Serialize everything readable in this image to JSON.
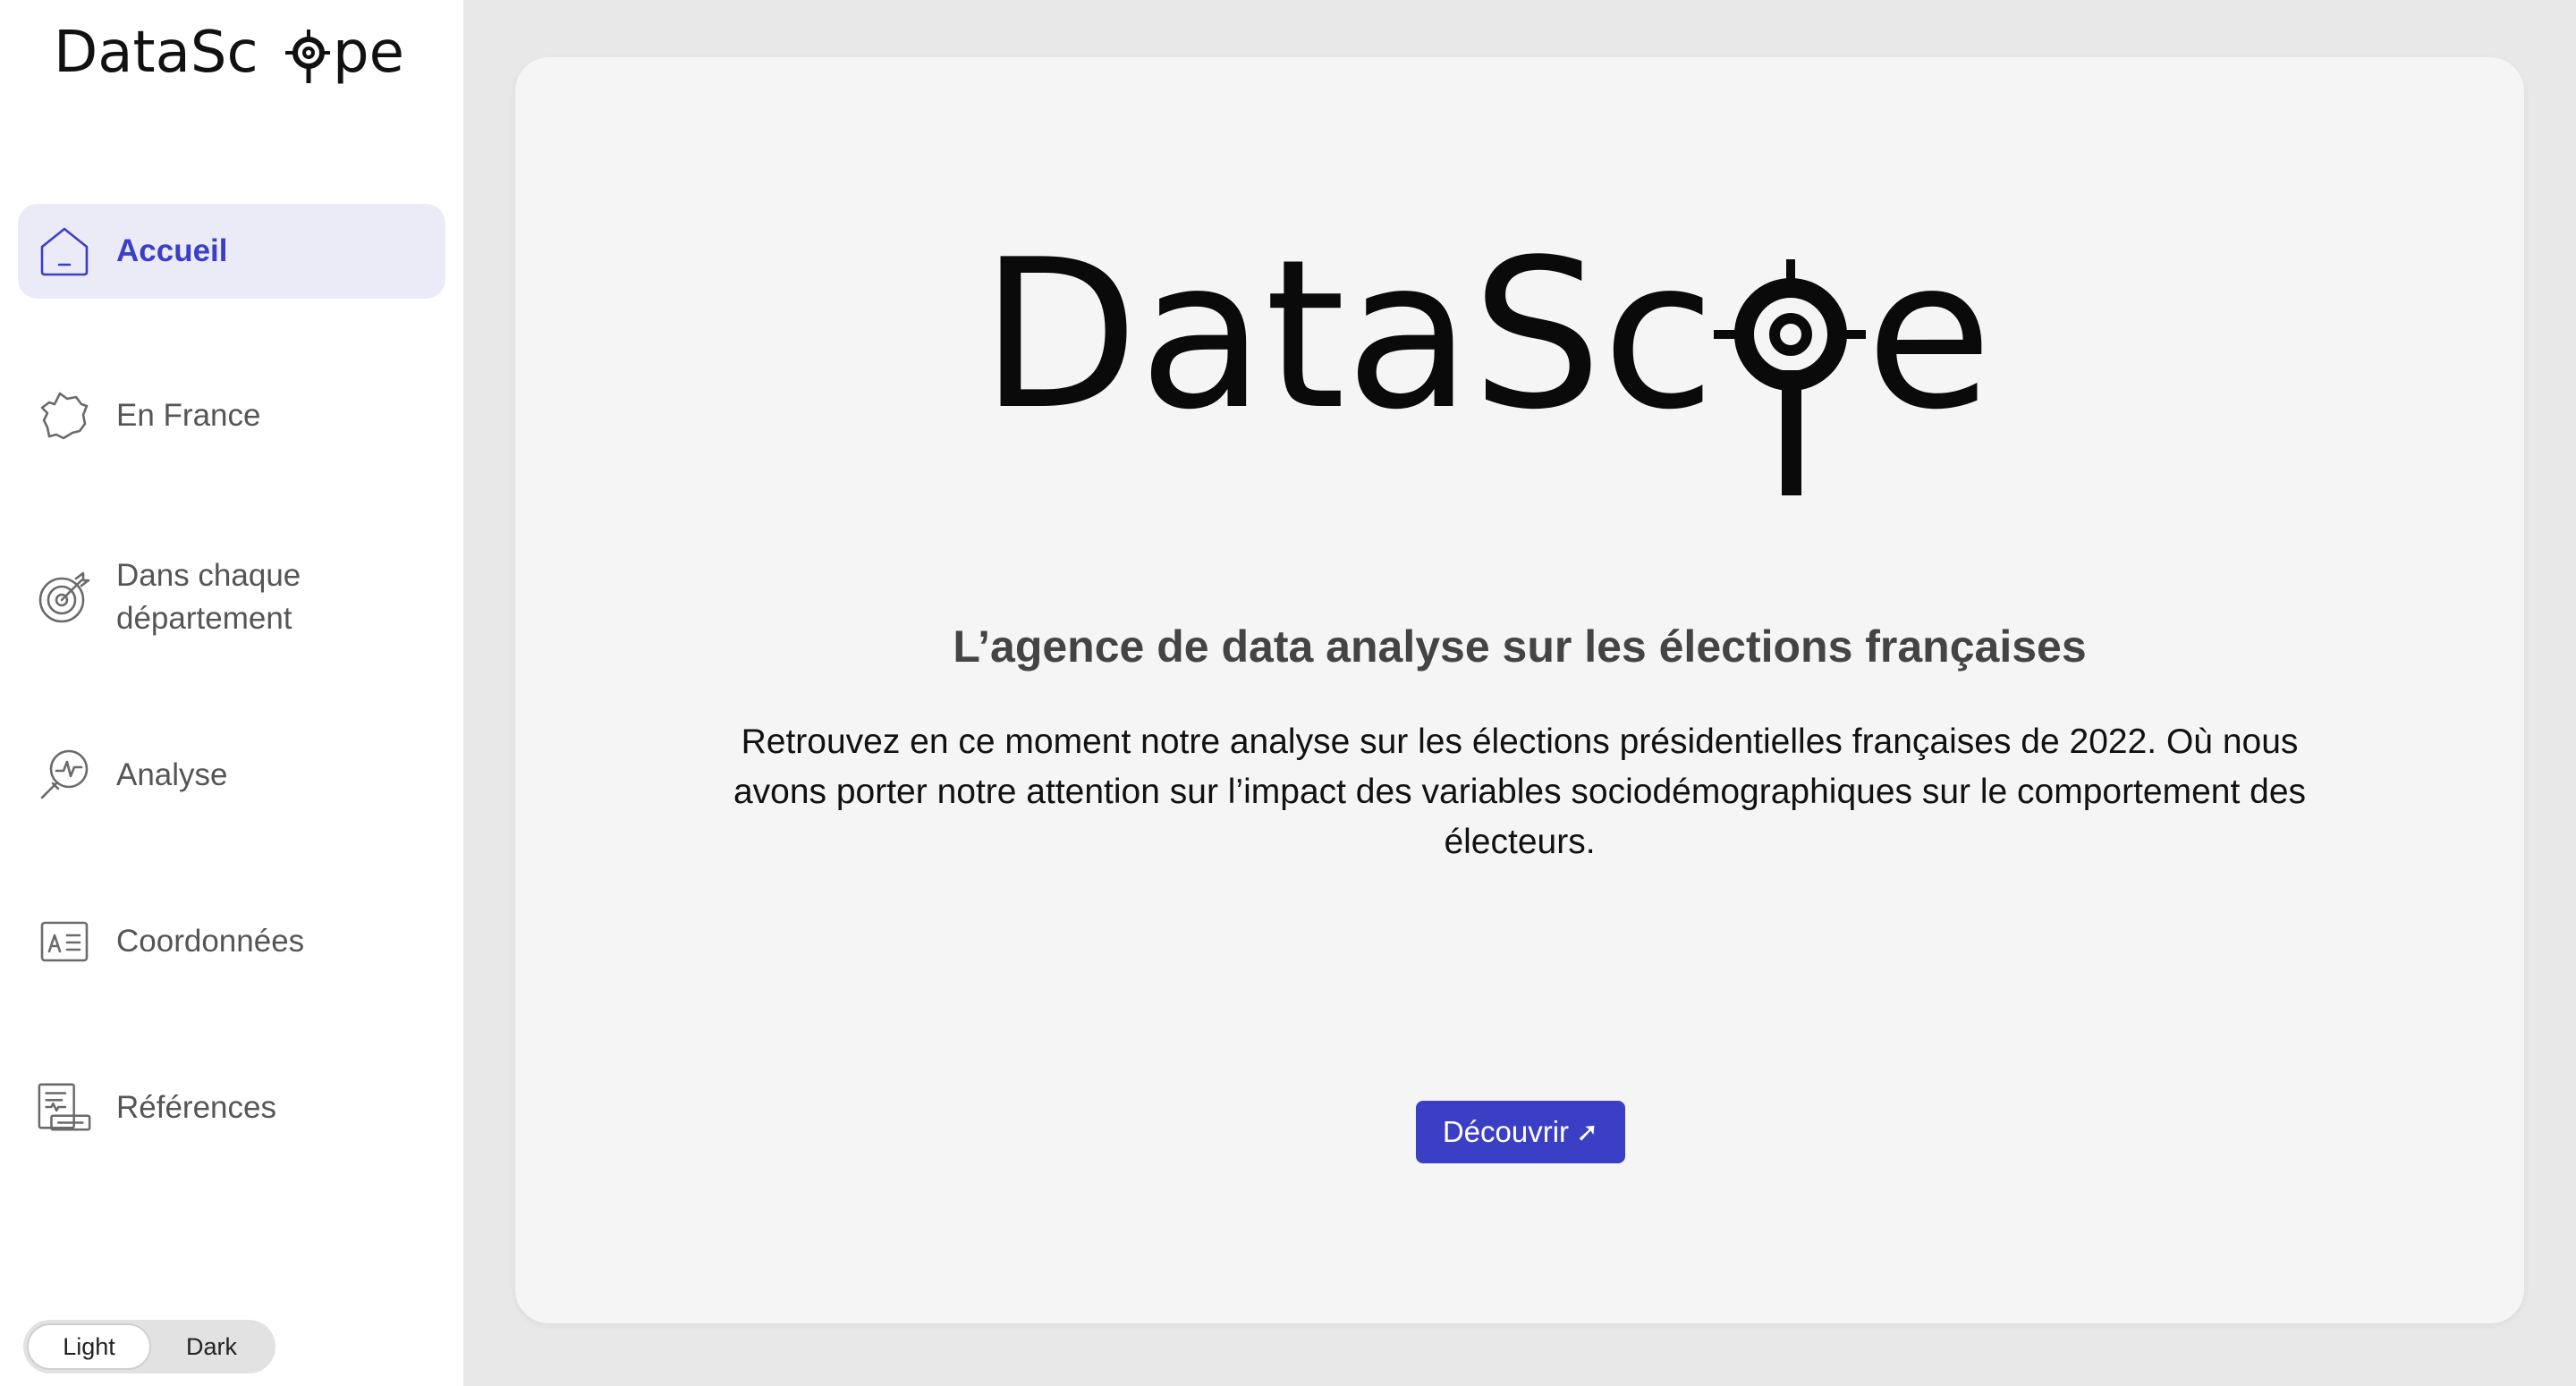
{
  "brand": {
    "name": "DataScope"
  },
  "sidebar": {
    "items": [
      {
        "label": "Accueil",
        "icon": "home-icon",
        "active": true
      },
      {
        "label": "En France",
        "icon": "france-map-icon",
        "active": false
      },
      {
        "label": "Dans chaque département",
        "icon": "target-icon",
        "active": false
      },
      {
        "label": "Analyse",
        "icon": "magnifier-chart-icon",
        "active": false
      },
      {
        "label": "Coordonnées",
        "icon": "contact-card-icon",
        "active": false
      },
      {
        "label": "Références",
        "icon": "documents-icon",
        "active": false
      }
    ]
  },
  "theme": {
    "light": "Light",
    "dark": "Dark",
    "selected": "Light"
  },
  "main": {
    "tagline": "L’agence de data analyse sur les élections françaises",
    "description": "Retrouvez en ce moment notre analyse sur les élections présidentielles françaises de 2022. Où nous avons porter notre attention sur l’impact des variables sociodémographiques sur le comportement des électeurs.",
    "cta_label": "Découvrir",
    "cta_icon": "arrow-up-right-icon"
  },
  "colors": {
    "accent": "#3b3fc6",
    "active_bg": "#ebebf8",
    "page_bg": "#e8e8e8",
    "card_bg": "#f5f5f5"
  }
}
